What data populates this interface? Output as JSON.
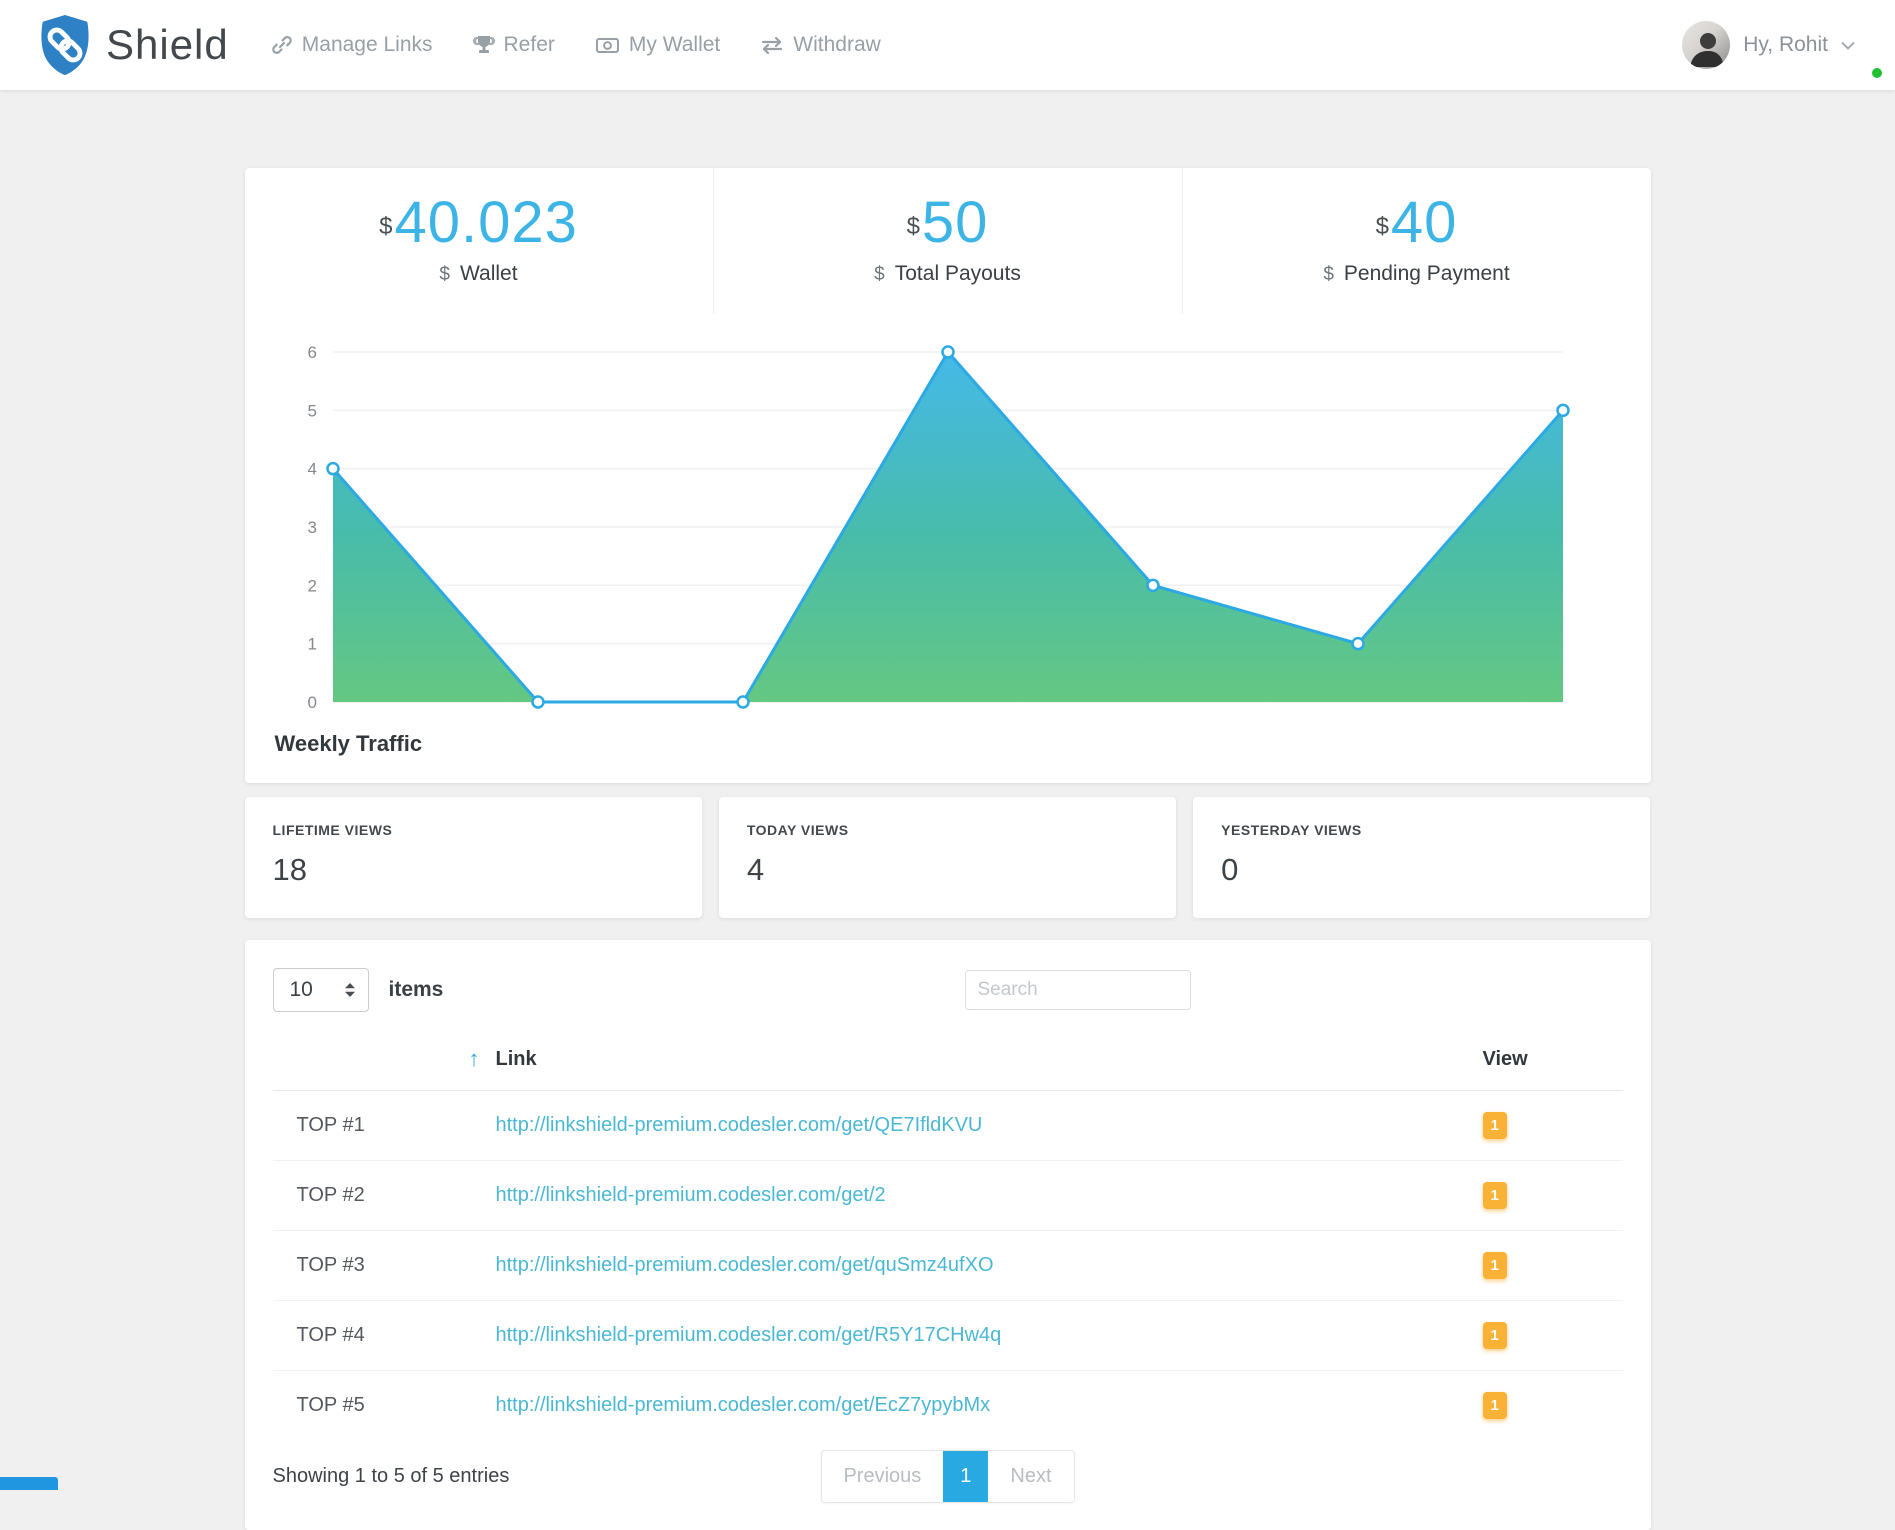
{
  "header": {
    "brand": "Shield",
    "nav": [
      {
        "icon": "link-icon",
        "label": "Manage Links"
      },
      {
        "icon": "trophy-icon",
        "label": "Refer"
      },
      {
        "icon": "wallet-icon",
        "label": "My Wallet"
      },
      {
        "icon": "withdraw-icon",
        "label": "Withdraw"
      }
    ],
    "user": {
      "name": "Hy, Rohit",
      "status": "online"
    }
  },
  "stats": [
    {
      "currency": "$",
      "value": "40.023",
      "label_prefix": "$",
      "label": "Wallet"
    },
    {
      "currency": "$",
      "value": "50",
      "label_prefix": "$",
      "label": "Total Payouts"
    },
    {
      "currency": "$",
      "value": "40",
      "label_prefix": "$",
      "label": "Pending Payment"
    }
  ],
  "chart_data": {
    "type": "area",
    "title": "Weekly Traffic",
    "x": [
      0,
      1,
      2,
      3,
      4,
      5,
      6
    ],
    "values": [
      4,
      0,
      0,
      6,
      2,
      1,
      5
    ],
    "ylim": [
      0,
      6
    ],
    "yticks": [
      0,
      1,
      2,
      3,
      4,
      5,
      6
    ],
    "grid": true,
    "legend": "none",
    "line_color": "#2ca9e2",
    "marker_fill": "#ffffff",
    "fill_gradient_top": "#3eb6e8",
    "fill_gradient_mid": "#40b9a9",
    "fill_gradient_bottom": "#5ec57d"
  },
  "view_cards": [
    {
      "label": "LIFETIME VIEWS",
      "value": "18"
    },
    {
      "label": "TODAY VIEWS",
      "value": "4"
    },
    {
      "label": "YESTERDAY VIEWS",
      "value": "0"
    }
  ],
  "table": {
    "page_size": "10",
    "items_label": "items",
    "search_placeholder": "Search",
    "sort_icon": "↑",
    "col_link": "Link",
    "col_view": "View",
    "rows": [
      {
        "rank": "TOP #1",
        "url": "http://linkshield-premium.codesler.com/get/QE7IfldKVU",
        "views": "1"
      },
      {
        "rank": "TOP #2",
        "url": "http://linkshield-premium.codesler.com/get/2",
        "views": "1"
      },
      {
        "rank": "TOP #3",
        "url": "http://linkshield-premium.codesler.com/get/quSmz4ufXO",
        "views": "1"
      },
      {
        "rank": "TOP #4",
        "url": "http://linkshield-premium.codesler.com/get/R5Y17CHw4q",
        "views": "1"
      },
      {
        "rank": "TOP #5",
        "url": "http://linkshield-premium.codesler.com/get/EcZ7ypybMx",
        "views": "1"
      }
    ],
    "summary": "Showing 1 to 5 of 5 entries",
    "pagination": {
      "previous": "Previous",
      "current": "1",
      "next": "Next"
    }
  },
  "colors": {
    "accent_blue": "#2ca9e2",
    "stat_blue": "#3cb4e6",
    "badge_orange": "#f9b236",
    "link_teal": "#4bb8d3",
    "online_green": "#21bf32",
    "logo_blue": "#2d81c4"
  }
}
